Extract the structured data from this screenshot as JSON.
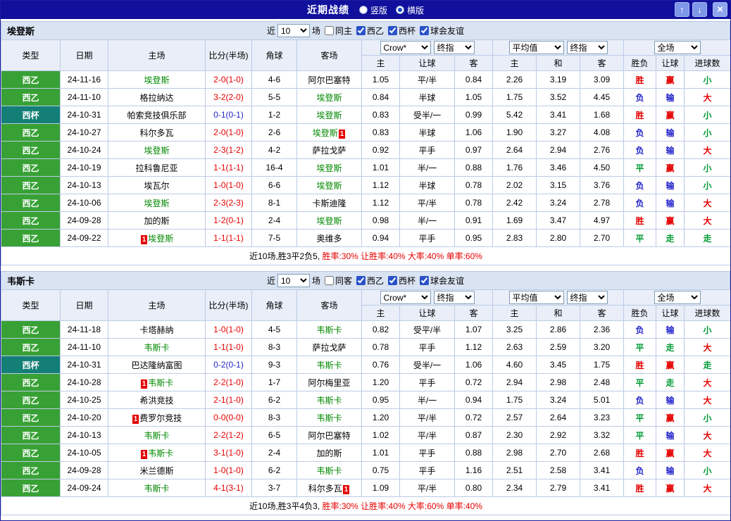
{
  "colors": {
    "red": "#e50000",
    "green": "#009933",
    "blue": "#2424cc",
    "black": "#000000",
    "team_green": "#008800",
    "liga_green": "#38a135",
    "cup_teal": "#137f76",
    "titlebar_blue": "#10109d"
  },
  "titlebar": {
    "title": "近期战绩",
    "layout_radios": [
      {
        "label": "竖版",
        "selected": false
      },
      {
        "label": "横版",
        "selected": true
      }
    ],
    "buttons": {
      "up_icon": "↑",
      "down_icon": "↓",
      "close_icon": "×"
    }
  },
  "filter_labels": {
    "near": "近",
    "count": "10",
    "matches": "场"
  },
  "table_header": {
    "static_cols": [
      "类型",
      "日期",
      "主场",
      "比分(半场)",
      "角球",
      "客场"
    ],
    "odds_selects": [
      "Crow*",
      "终指"
    ],
    "avg_selects": [
      "平均值",
      "终指"
    ],
    "scope_select": "全场",
    "sub_cols": [
      "主",
      "让球",
      "客",
      "主",
      "和",
      "客",
      "胜负",
      "让球",
      "进球数"
    ]
  },
  "sections": [
    {
      "team": "埃登斯",
      "filters": [
        {
          "label": "同主",
          "checked": false
        },
        {
          "label": "西乙",
          "checked": true
        },
        {
          "label": "西杯",
          "checked": true
        },
        {
          "label": "球会友谊",
          "checked": true
        }
      ],
      "rows": [
        {
          "league": "西乙",
          "league_type": "liga",
          "date": "24-11-16",
          "home": {
            "name": "埃登斯",
            "self": true
          },
          "score": {
            "t": "2-0(1-0)",
            "c": "red"
          },
          "corner": "4-6",
          "away": {
            "name": "阿尔巴塞特",
            "self": false
          },
          "odds": [
            "1.05",
            "平/半",
            "0.84"
          ],
          "avg": [
            "2.26",
            "3.19",
            "3.09"
          ],
          "verdicts": [
            {
              "t": "胜",
              "c": "red"
            },
            {
              "t": "赢",
              "c": "red"
            },
            {
              "t": "小",
              "c": "green"
            }
          ]
        },
        {
          "league": "西乙",
          "league_type": "liga",
          "date": "24-11-10",
          "home": {
            "name": "格拉纳达",
            "self": false
          },
          "score": {
            "t": "3-2(2-0)",
            "c": "red"
          },
          "corner": "5-5",
          "away": {
            "name": "埃登斯",
            "self": true
          },
          "odds": [
            "0.84",
            "半球",
            "1.05"
          ],
          "avg": [
            "1.75",
            "3.52",
            "4.45"
          ],
          "verdicts": [
            {
              "t": "负",
              "c": "blue"
            },
            {
              "t": "输",
              "c": "blue"
            },
            {
              "t": "大",
              "c": "red"
            }
          ]
        },
        {
          "league": "西杯",
          "league_type": "cup",
          "date": "24-10-31",
          "home": {
            "name": "帕索竞技俱乐部",
            "self": false
          },
          "score": {
            "t": "0-1(0-1)",
            "c": "blue"
          },
          "corner": "1-2",
          "away": {
            "name": "埃登斯",
            "self": true
          },
          "odds": [
            "0.83",
            "受半/一",
            "0.99"
          ],
          "avg": [
            "5.42",
            "3.41",
            "1.68"
          ],
          "verdicts": [
            {
              "t": "胜",
              "c": "red"
            },
            {
              "t": "赢",
              "c": "red"
            },
            {
              "t": "小",
              "c": "green"
            }
          ]
        },
        {
          "league": "西乙",
          "league_type": "liga",
          "date": "24-10-27",
          "home": {
            "name": "科尔多瓦",
            "self": false
          },
          "score": {
            "t": "2-0(1-0)",
            "c": "red"
          },
          "corner": "2-6",
          "away": {
            "name": "埃登斯",
            "self": true,
            "card": "1",
            "card_pos": "right"
          },
          "odds": [
            "0.83",
            "半球",
            "1.06"
          ],
          "avg": [
            "1.90",
            "3.27",
            "4.08"
          ],
          "verdicts": [
            {
              "t": "负",
              "c": "blue"
            },
            {
              "t": "输",
              "c": "blue"
            },
            {
              "t": "小",
              "c": "green"
            }
          ]
        },
        {
          "league": "西乙",
          "league_type": "liga",
          "date": "24-10-24",
          "home": {
            "name": "埃登斯",
            "self": true
          },
          "score": {
            "t": "2-3(1-2)",
            "c": "red"
          },
          "corner": "4-2",
          "away": {
            "name": "萨拉戈萨",
            "self": false
          },
          "odds": [
            "0.92",
            "平手",
            "0.97"
          ],
          "avg": [
            "2.64",
            "2.94",
            "2.76"
          ],
          "verdicts": [
            {
              "t": "负",
              "c": "blue"
            },
            {
              "t": "输",
              "c": "blue"
            },
            {
              "t": "大",
              "c": "red"
            }
          ]
        },
        {
          "league": "西乙",
          "league_type": "liga",
          "date": "24-10-19",
          "home": {
            "name": "拉科鲁尼亚",
            "self": false
          },
          "score": {
            "t": "1-1(1-1)",
            "c": "red"
          },
          "corner": "16-4",
          "away": {
            "name": "埃登斯",
            "self": true
          },
          "odds": [
            "1.01",
            "半/一",
            "0.88"
          ],
          "avg": [
            "1.76",
            "3.46",
            "4.50"
          ],
          "verdicts": [
            {
              "t": "平",
              "c": "green"
            },
            {
              "t": "赢",
              "c": "red"
            },
            {
              "t": "小",
              "c": "green"
            }
          ]
        },
        {
          "league": "西乙",
          "league_type": "liga",
          "date": "24-10-13",
          "home": {
            "name": "埃瓦尔",
            "self": false
          },
          "score": {
            "t": "1-0(1-0)",
            "c": "red"
          },
          "corner": "6-6",
          "away": {
            "name": "埃登斯",
            "self": true
          },
          "odds": [
            "1.12",
            "半球",
            "0.78"
          ],
          "avg": [
            "2.02",
            "3.15",
            "3.76"
          ],
          "verdicts": [
            {
              "t": "负",
              "c": "blue"
            },
            {
              "t": "输",
              "c": "blue"
            },
            {
              "t": "小",
              "c": "green"
            }
          ]
        },
        {
          "league": "西乙",
          "league_type": "liga",
          "date": "24-10-06",
          "home": {
            "name": "埃登斯",
            "self": true
          },
          "score": {
            "t": "2-3(2-3)",
            "c": "red"
          },
          "corner": "8-1",
          "away": {
            "name": "卡斯迪隆",
            "self": false
          },
          "odds": [
            "1.12",
            "平/半",
            "0.78"
          ],
          "avg": [
            "2.42",
            "3.24",
            "2.78"
          ],
          "verdicts": [
            {
              "t": "负",
              "c": "blue"
            },
            {
              "t": "输",
              "c": "blue"
            },
            {
              "t": "大",
              "c": "red"
            }
          ]
        },
        {
          "league": "西乙",
          "league_type": "liga",
          "date": "24-09-28",
          "home": {
            "name": "加的斯",
            "self": false
          },
          "score": {
            "t": "1-2(0-1)",
            "c": "red"
          },
          "corner": "2-4",
          "away": {
            "name": "埃登斯",
            "self": true
          },
          "odds": [
            "0.98",
            "半/一",
            "0.91"
          ],
          "avg": [
            "1.69",
            "3.47",
            "4.97"
          ],
          "verdicts": [
            {
              "t": "胜",
              "c": "red"
            },
            {
              "t": "赢",
              "c": "red"
            },
            {
              "t": "大",
              "c": "red"
            }
          ]
        },
        {
          "league": "西乙",
          "league_type": "liga",
          "date": "24-09-22",
          "home": {
            "name": "埃登斯",
            "self": true,
            "card": "1",
            "card_pos": "left"
          },
          "score": {
            "t": "1-1(1-1)",
            "c": "red"
          },
          "corner": "7-5",
          "away": {
            "name": "奥维多",
            "self": false
          },
          "odds": [
            "0.94",
            "平手",
            "0.95"
          ],
          "avg": [
            "2.83",
            "2.80",
            "2.70"
          ],
          "verdicts": [
            {
              "t": "平",
              "c": "green"
            },
            {
              "t": "走",
              "c": "green"
            },
            {
              "t": "走",
              "c": "green"
            }
          ]
        }
      ],
      "summary": [
        {
          "t": "近10场,胜3平2负5, ",
          "c": "black"
        },
        {
          "t": "胜率:30%",
          "c": "red"
        },
        {
          "t": " 让胜率:40%",
          "c": "red"
        },
        {
          "t": " 大率:40%",
          "c": "red"
        },
        {
          "t": " 单率:60%",
          "c": "red"
        }
      ]
    },
    {
      "team": "韦斯卡",
      "filters": [
        {
          "label": "同客",
          "checked": false
        },
        {
          "label": "西乙",
          "checked": true
        },
        {
          "label": "西杯",
          "checked": true
        },
        {
          "label": "球会友谊",
          "checked": true
        }
      ],
      "rows": [
        {
          "league": "西乙",
          "league_type": "liga",
          "date": "24-11-18",
          "home": {
            "name": "卡塔赫纳",
            "self": false
          },
          "score": {
            "t": "1-0(1-0)",
            "c": "red"
          },
          "corner": "4-5",
          "away": {
            "name": "韦斯卡",
            "self": true
          },
          "odds": [
            "0.82",
            "受平/半",
            "1.07"
          ],
          "avg": [
            "3.25",
            "2.86",
            "2.36"
          ],
          "verdicts": [
            {
              "t": "负",
              "c": "blue"
            },
            {
              "t": "输",
              "c": "blue"
            },
            {
              "t": "小",
              "c": "green"
            }
          ]
        },
        {
          "league": "西乙",
          "league_type": "liga",
          "date": "24-11-10",
          "home": {
            "name": "韦斯卡",
            "self": true
          },
          "score": {
            "t": "1-1(1-0)",
            "c": "red"
          },
          "corner": "8-3",
          "away": {
            "name": "萨拉戈萨",
            "self": false
          },
          "odds": [
            "0.78",
            "平手",
            "1.12"
          ],
          "avg": [
            "2.63",
            "2.59",
            "3.20"
          ],
          "verdicts": [
            {
              "t": "平",
              "c": "green"
            },
            {
              "t": "走",
              "c": "green"
            },
            {
              "t": "大",
              "c": "red"
            }
          ]
        },
        {
          "league": "西杯",
          "league_type": "cup",
          "date": "24-10-31",
          "home": {
            "name": "巴达隆纳富图",
            "self": false
          },
          "score": {
            "t": "0-2(0-1)",
            "c": "blue"
          },
          "corner": "9-3",
          "away": {
            "name": "韦斯卡",
            "self": true
          },
          "odds": [
            "0.76",
            "受半/一",
            "1.06"
          ],
          "avg": [
            "4.60",
            "3.45",
            "1.75"
          ],
          "verdicts": [
            {
              "t": "胜",
              "c": "red"
            },
            {
              "t": "赢",
              "c": "red"
            },
            {
              "t": "走",
              "c": "green"
            }
          ]
        },
        {
          "league": "西乙",
          "league_type": "liga",
          "date": "24-10-28",
          "home": {
            "name": "韦斯卡",
            "self": true,
            "card": "1",
            "card_pos": "left"
          },
          "score": {
            "t": "2-2(1-0)",
            "c": "red"
          },
          "corner": "1-7",
          "away": {
            "name": "阿尔梅里亚",
            "self": false
          },
          "odds": [
            "1.20",
            "平手",
            "0.72"
          ],
          "avg": [
            "2.94",
            "2.98",
            "2.48"
          ],
          "verdicts": [
            {
              "t": "平",
              "c": "green"
            },
            {
              "t": "走",
              "c": "green"
            },
            {
              "t": "大",
              "c": "red"
            }
          ]
        },
        {
          "league": "西乙",
          "league_type": "liga",
          "date": "24-10-25",
          "home": {
            "name": "希洪竞技",
            "self": false
          },
          "score": {
            "t": "2-1(1-0)",
            "c": "red"
          },
          "corner": "6-2",
          "away": {
            "name": "韦斯卡",
            "self": true
          },
          "odds": [
            "0.95",
            "半/一",
            "0.94"
          ],
          "avg": [
            "1.75",
            "3.24",
            "5.01"
          ],
          "verdicts": [
            {
              "t": "负",
              "c": "blue"
            },
            {
              "t": "输",
              "c": "blue"
            },
            {
              "t": "大",
              "c": "red"
            }
          ]
        },
        {
          "league": "西乙",
          "league_type": "liga",
          "date": "24-10-20",
          "home": {
            "name": "费罗尔竞技",
            "self": false,
            "card": "1",
            "card_pos": "left"
          },
          "score": {
            "t": "0-0(0-0)",
            "c": "red"
          },
          "corner": "8-3",
          "away": {
            "name": "韦斯卡",
            "self": true
          },
          "odds": [
            "1.20",
            "平/半",
            "0.72"
          ],
          "avg": [
            "2.57",
            "2.64",
            "3.23"
          ],
          "verdicts": [
            {
              "t": "平",
              "c": "green"
            },
            {
              "t": "赢",
              "c": "red"
            },
            {
              "t": "小",
              "c": "green"
            }
          ]
        },
        {
          "league": "西乙",
          "league_type": "liga",
          "date": "24-10-13",
          "home": {
            "name": "韦斯卡",
            "self": true
          },
          "score": {
            "t": "2-2(1-2)",
            "c": "red"
          },
          "corner": "6-5",
          "away": {
            "name": "阿尔巴塞特",
            "self": false
          },
          "odds": [
            "1.02",
            "平/半",
            "0.87"
          ],
          "avg": [
            "2.30",
            "2.92",
            "3.32"
          ],
          "verdicts": [
            {
              "t": "平",
              "c": "green"
            },
            {
              "t": "输",
              "c": "blue"
            },
            {
              "t": "大",
              "c": "red"
            }
          ]
        },
        {
          "league": "西乙",
          "league_type": "liga",
          "date": "24-10-05",
          "home": {
            "name": "韦斯卡",
            "self": true,
            "card": "1",
            "card_pos": "left"
          },
          "score": {
            "t": "3-1(1-0)",
            "c": "red"
          },
          "corner": "2-4",
          "away": {
            "name": "加的斯",
            "self": false
          },
          "odds": [
            "1.01",
            "平手",
            "0.88"
          ],
          "avg": [
            "2.98",
            "2.70",
            "2.68"
          ],
          "verdicts": [
            {
              "t": "胜",
              "c": "red"
            },
            {
              "t": "赢",
              "c": "red"
            },
            {
              "t": "大",
              "c": "red"
            }
          ]
        },
        {
          "league": "西乙",
          "league_type": "liga",
          "date": "24-09-28",
          "home": {
            "name": "米兰德斯",
            "self": false
          },
          "score": {
            "t": "1-0(1-0)",
            "c": "red"
          },
          "corner": "6-2",
          "away": {
            "name": "韦斯卡",
            "self": true
          },
          "odds": [
            "0.75",
            "平手",
            "1.16"
          ],
          "avg": [
            "2.51",
            "2.58",
            "3.41"
          ],
          "verdicts": [
            {
              "t": "负",
              "c": "blue"
            },
            {
              "t": "输",
              "c": "blue"
            },
            {
              "t": "小",
              "c": "green"
            }
          ]
        },
        {
          "league": "西乙",
          "league_type": "liga",
          "date": "24-09-24",
          "home": {
            "name": "韦斯卡",
            "self": true
          },
          "score": {
            "t": "4-1(3-1)",
            "c": "red"
          },
          "corner": "3-7",
          "away": {
            "name": "科尔多瓦",
            "self": false,
            "card": "1",
            "card_pos": "right"
          },
          "odds": [
            "1.09",
            "平/半",
            "0.80"
          ],
          "avg": [
            "2.34",
            "2.79",
            "3.41"
          ],
          "verdicts": [
            {
              "t": "胜",
              "c": "red"
            },
            {
              "t": "赢",
              "c": "red"
            },
            {
              "t": "大",
              "c": "red"
            }
          ]
        }
      ],
      "summary": [
        {
          "t": "近10场,胜3平4负3, ",
          "c": "black"
        },
        {
          "t": "胜率:30%",
          "c": "red"
        },
        {
          "t": " 让胜率:40%",
          "c": "red"
        },
        {
          "t": " 大率:60%",
          "c": "red"
        },
        {
          "t": " 单率:40%",
          "c": "red"
        }
      ]
    }
  ]
}
